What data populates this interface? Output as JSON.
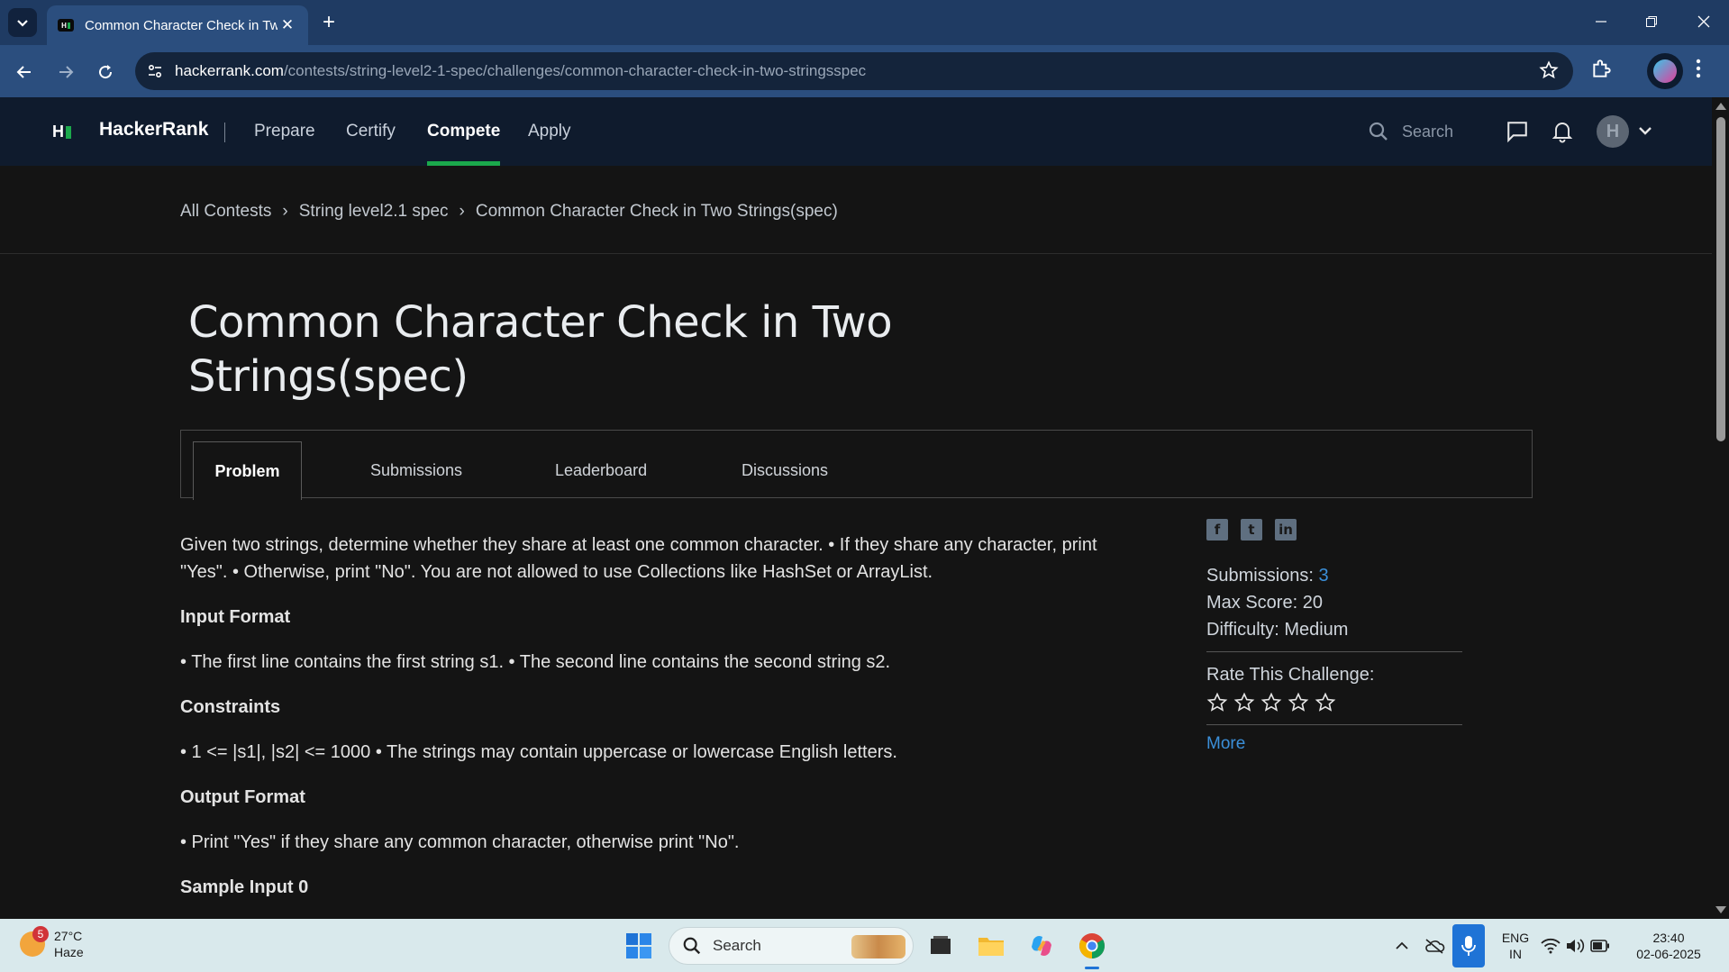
{
  "browser": {
    "tab_title": "Common Character Check in Two Strings(spec) | HackerRank",
    "url_host": "hackerrank.com",
    "url_path": "/contests/string-level2-1-spec/challenges/common-character-check-in-two-stringsspec"
  },
  "header": {
    "logo_text": "H",
    "brand": "HackerRank",
    "nav": [
      "Prepare",
      "Certify",
      "Compete",
      "Apply"
    ],
    "active_nav": "Compete",
    "search_placeholder": "Search",
    "avatar_letter": "H"
  },
  "breadcrumb": [
    "All Contests",
    "String level2.1 spec",
    "Common Character Check in Two Strings(spec)"
  ],
  "page_title": "Common Character Check in Two Strings(spec)",
  "tabs": [
    "Problem",
    "Submissions",
    "Leaderboard",
    "Discussions"
  ],
  "problem": {
    "statement": "Given two strings, determine whether they share at least one common character. • If they share any character, print \"Yes\". • Otherwise, print \"No\". You are not allowed to use Collections like HashSet or ArrayList.",
    "input_format_heading": "Input Format",
    "input_format": "• The first line contains the first string s1. • The second line contains the second string s2.",
    "constraints_heading": "Constraints",
    "constraints": "• 1 <= |s1|, |s2| <= 1000 • The strings may contain uppercase or lowercase English letters.",
    "output_format_heading": "Output Format",
    "output_format": "• Print \"Yes\" if they share any common character, otherwise print \"No\".",
    "sample_input_heading": "Sample Input 0"
  },
  "sidebar": {
    "submissions_label": "Submissions: ",
    "submissions_value": "3",
    "max_score": "Max Score: 20",
    "difficulty": "Difficulty: Medium",
    "rate_label": "Rate This Challenge:",
    "rating": 0,
    "rating_max": 5,
    "more_link": "More",
    "social_icons": [
      "facebook-icon",
      "twitter-icon",
      "linkedin-icon"
    ]
  },
  "taskbar": {
    "weather_badge": "5",
    "temperature": "27°C",
    "condition": "Haze",
    "search_placeholder": "Search",
    "lang_top": "ENG",
    "lang_bottom": "IN",
    "time": "23:40",
    "date": "02-06-2025"
  },
  "colors": {
    "accent_green": "#1ba94c",
    "link_blue": "#3b8fd9",
    "chrome_blue": "#2b4e7e",
    "header_navy": "#0f1b2d"
  }
}
